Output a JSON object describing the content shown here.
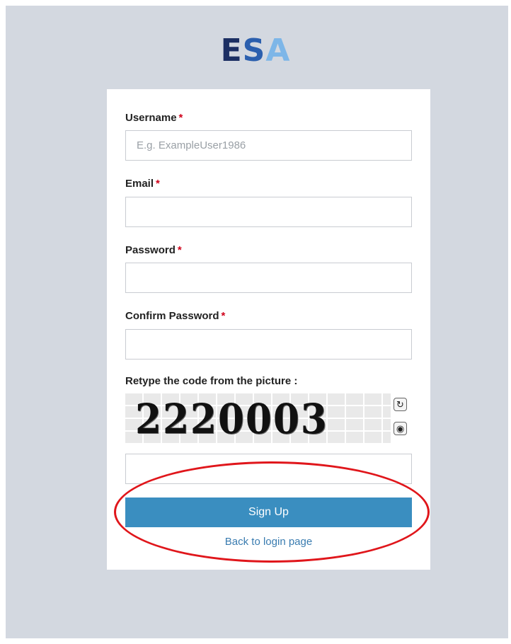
{
  "logo": {
    "part1": "E",
    "part2": "S",
    "part3": "A"
  },
  "form": {
    "username": {
      "label": "Username",
      "required_mark": "*",
      "placeholder": "E.g. ExampleUser1986",
      "value": ""
    },
    "email": {
      "label": "Email",
      "required_mark": "*",
      "value": ""
    },
    "password": {
      "label": "Password",
      "required_mark": "*",
      "value": ""
    },
    "confirm_password": {
      "label": "Confirm Password",
      "required_mark": "*",
      "value": ""
    },
    "captcha": {
      "label": "Retype the code from the picture :",
      "code": "2220003",
      "refresh_icon": "refresh-icon",
      "audio_icon": "audio-icon",
      "value": ""
    },
    "signup_label": "Sign Up",
    "back_link_label": "Back to login page"
  },
  "colors": {
    "background": "#d3d8e0",
    "button": "#3a8ec0",
    "link": "#3a7cb0",
    "required": "#d0021b",
    "annotation": "#e0161b"
  }
}
